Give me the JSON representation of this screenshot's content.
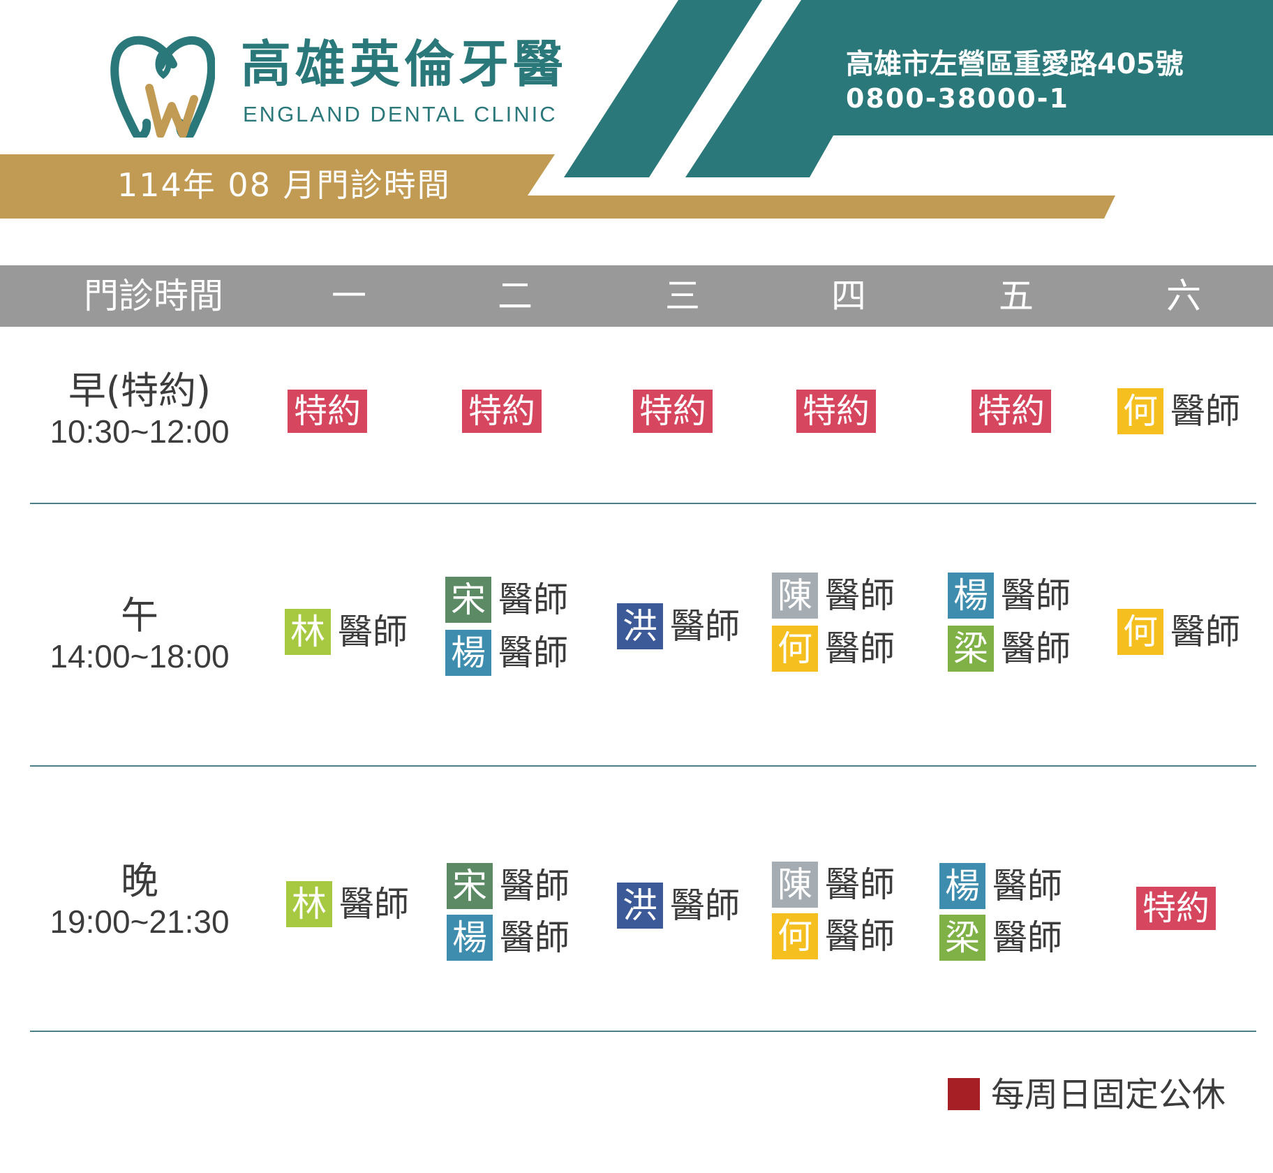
{
  "clinic": {
    "name": "高雄英倫牙醫",
    "name_en": "ENGLAND DENTAL CLINIC",
    "address": "高雄市左營區重愛路405號",
    "phone": "0800-38000-1"
  },
  "schedule_title": "114年 08 月門診時間",
  "colors": {
    "teal": "#2b787b",
    "gold": "#c19b53",
    "header_gray": "#999999",
    "special": "#d6465e",
    "legend": "#a51f24",
    "doctor_lin": "#a7c942",
    "doctor_song": "#5b8a64",
    "doctor_yang": "#3e8cae",
    "doctor_hong": "#3d5a98",
    "doctor_chen": "#a5adb3",
    "doctor_he": "#f5bf1f",
    "doctor_liang": "#7fb146"
  },
  "table": {
    "header": [
      "門診時間",
      "一",
      "二",
      "三",
      "四",
      "五",
      "六"
    ],
    "doctor_suffix": "醫師",
    "special_label": "特約",
    "rows": [
      {
        "name": "早(特約)",
        "time": "10:30~12:00",
        "cells": [
          {
            "type": "special"
          },
          {
            "type": "special"
          },
          {
            "type": "special"
          },
          {
            "type": "special"
          },
          {
            "type": "special"
          },
          {
            "type": "doctors",
            "doctors": [
              "何"
            ]
          }
        ]
      },
      {
        "name": "午",
        "time": "14:00~18:00",
        "cells": [
          {
            "type": "doctors",
            "doctors": [
              "林"
            ]
          },
          {
            "type": "doctors",
            "doctors": [
              "宋",
              "楊"
            ]
          },
          {
            "type": "doctors",
            "doctors": [
              "洪"
            ]
          },
          {
            "type": "doctors",
            "doctors": [
              "陳",
              "何"
            ]
          },
          {
            "type": "doctors",
            "doctors": [
              "楊",
              "梁"
            ]
          },
          {
            "type": "doctors",
            "doctors": [
              "何"
            ]
          }
        ]
      },
      {
        "name": "晚",
        "time": "19:00~21:30",
        "cells": [
          {
            "type": "doctors",
            "doctors": [
              "林"
            ]
          },
          {
            "type": "doctors",
            "doctors": [
              "宋",
              "楊"
            ]
          },
          {
            "type": "doctors",
            "doctors": [
              "洪"
            ]
          },
          {
            "type": "doctors",
            "doctors": [
              "陳",
              "何"
            ]
          },
          {
            "type": "doctors",
            "doctors": [
              "楊",
              "梁"
            ]
          },
          {
            "type": "special"
          }
        ]
      }
    ]
  },
  "legend": {
    "text": "每周日固定公休"
  }
}
